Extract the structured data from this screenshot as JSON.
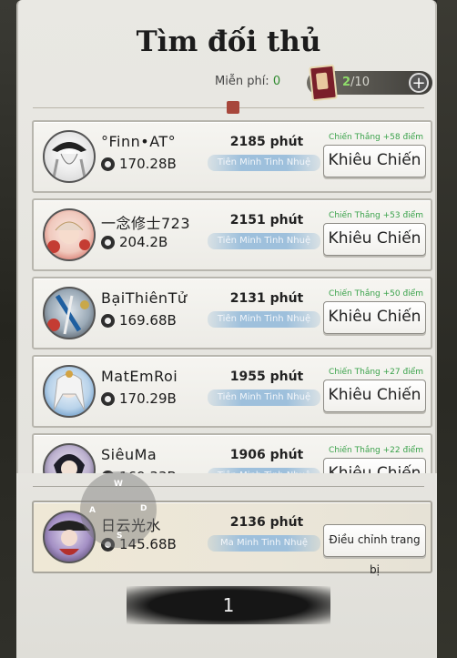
{
  "title": "Tìm đối thủ",
  "free": {
    "label": "Miễn phí:",
    "value": "0"
  },
  "tickets": {
    "current": "2",
    "max": "/10",
    "plus": "+"
  },
  "opponents": [
    {
      "name": "°Finn•AT°",
      "power": "170.28B",
      "minutes": "2185 phút",
      "rank": "Tiên Minh Tinh Nhuệ",
      "win": "Chiến Thắng +58 điểm",
      "button": "Khiêu Chiến",
      "avatar_color": "#f0ede6"
    },
    {
      "name": "一念修士723",
      "power": "204.2B",
      "minutes": "2151 phút",
      "rank": "Tiên Minh Tinh Nhuệ",
      "win": "Chiến Thắng +53 điểm",
      "button": "Khiêu Chiến",
      "avatar_color": "#f4d7cf"
    },
    {
      "name": "BạiThiênTử",
      "power": "169.68B",
      "minutes": "2131 phút",
      "rank": "Tiên Minh Tinh Nhuệ",
      "win": "Chiến Thắng +50 điểm",
      "button": "Khiêu Chiến",
      "avatar_color": "#cfd6dc"
    },
    {
      "name": "MatEmRoi",
      "power": "170.29B",
      "minutes": "1955 phút",
      "rank": "Tiên Minh Tinh Nhuệ",
      "win": "Chiến Thắng +27 điểm",
      "button": "Khiêu Chiến",
      "avatar_color": "#cde0ef"
    },
    {
      "name": "SiêuMa",
      "power": "169.33B",
      "minutes": "1906 phút",
      "rank": "Tiên Minh Tinh Nhuệ",
      "win": "Chiến Thắng +22 điểm",
      "button": "Khiêu Chiến",
      "avatar_color": "#d8d0e6"
    }
  ],
  "me": {
    "name": "日云光水",
    "power": "145.68B",
    "minutes": "2136 phút",
    "rank": "Ma Minh Tinh Nhuệ",
    "button": "Điều chỉnh trang bị"
  },
  "joystick": {
    "w": "W",
    "a": "A",
    "s": "S",
    "d": "D"
  },
  "page": "1"
}
